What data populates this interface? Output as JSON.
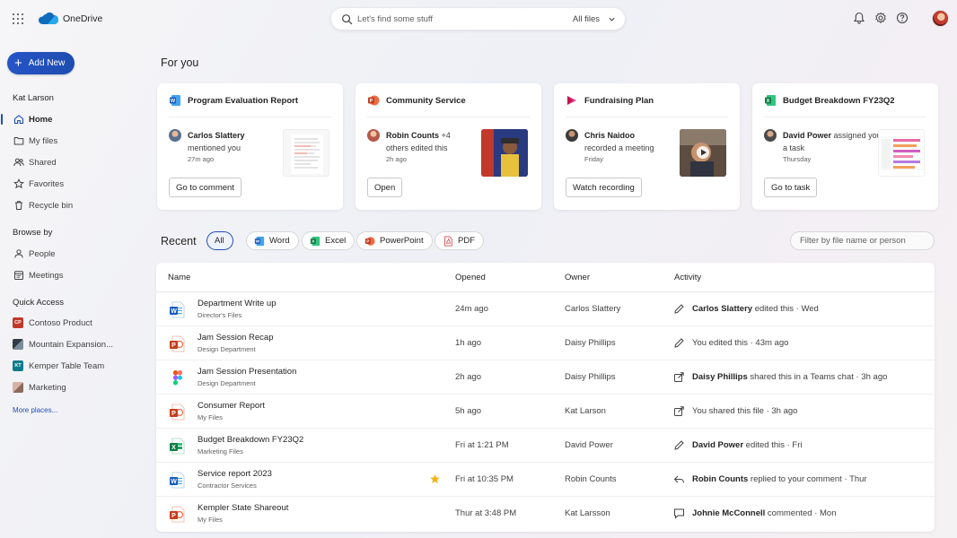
{
  "app": {
    "brand": "OneDrive"
  },
  "search": {
    "placeholder": "Let's find some stuff",
    "scope": "All files"
  },
  "sidebar": {
    "add_new": "Add New",
    "user": "Kat Larson",
    "nav": [
      {
        "label": "Home",
        "icon": "home-icon",
        "active": true
      },
      {
        "label": "My files",
        "icon": "folder-icon"
      },
      {
        "label": "Shared",
        "icon": "people-icon"
      },
      {
        "label": "Favorites",
        "icon": "star-icon"
      },
      {
        "label": "Recycle bin",
        "icon": "trash-icon"
      }
    ],
    "browse_by_title": "Browse by",
    "browse": [
      {
        "label": "People",
        "icon": "person-icon"
      },
      {
        "label": "Meetings",
        "icon": "calendar-icon"
      }
    ],
    "quick_access_title": "Quick Access",
    "quick_access": [
      {
        "label": "Contoso Product",
        "badge": "CP",
        "color": "#c0392b"
      },
      {
        "label": "Mountain Expansion...",
        "badge": "",
        "color": "#2f3b45"
      },
      {
        "label": "Kemper Table Team",
        "badge": "KT",
        "color": "#0f7b8a"
      },
      {
        "label": "Marketing",
        "badge": "",
        "color": "#b98a7a"
      }
    ],
    "more_places": "More places..."
  },
  "for_you": {
    "title": "For you",
    "cards": [
      {
        "app": "word",
        "title": "Program Evaluation Report",
        "person": "Carlos Slattery",
        "action": "mentioned you",
        "time": "27m ago",
        "button": "Go to comment"
      },
      {
        "app": "powerpoint",
        "title": "Community Service",
        "person": "Robin Counts",
        "extra": "+4",
        "action": "others edited this",
        "time": "2h ago",
        "button": "Open"
      },
      {
        "app": "stream",
        "title": "Fundraising Plan",
        "person": "Chris Naidoo",
        "action": "recorded a meeting",
        "time": "Friday",
        "button": "Watch recording"
      },
      {
        "app": "excel",
        "title": "Budget Breakdown FY23Q2",
        "person": "David Power",
        "action": "assigned you a task",
        "time": "Thursday",
        "button": "Go to task"
      }
    ]
  },
  "recent": {
    "title": "Recent",
    "chips": [
      "All",
      "Word",
      "Excel",
      "PowerPoint",
      "PDF"
    ],
    "filter_placeholder": "Filter by file name or person",
    "columns": [
      "Name",
      "Opened",
      "Owner",
      "Activity"
    ],
    "rows": [
      {
        "type": "word",
        "name": "Department Write up",
        "location": "Director's Files",
        "opened": "24m ago",
        "owner": "Carlos Slattery",
        "activity_icon": "pencil-icon",
        "actor": "Carlos Slattery",
        "activity": " edited this · Wed"
      },
      {
        "type": "powerpoint",
        "name": "Jam Session Recap",
        "location": "Design Department",
        "opened": "1h ago",
        "owner": "Daisy Phillips",
        "activity_icon": "pencil-icon",
        "actor": "",
        "activity": "You edited this · 43m ago"
      },
      {
        "type": "figma",
        "name": "Jam Session Presentation",
        "location": "Design Department",
        "opened": "2h ago",
        "owner": "Daisy Phillips",
        "activity_icon": "share-icon",
        "actor": "Daisy Phillips",
        "activity": " shared this in a Teams chat · 3h ago"
      },
      {
        "type": "powerpoint",
        "name": "Consumer Report",
        "location": "My Files",
        "opened": "5h ago",
        "owner": "Kat Larson",
        "activity_icon": "share-icon",
        "actor": "",
        "activity": "You shared this file · 3h ago"
      },
      {
        "type": "excel",
        "name": "Budget Breakdown FY23Q2",
        "location": "Marketing Files",
        "opened": "Fri at 1:21 PM",
        "owner": "David Power",
        "activity_icon": "pencil-icon",
        "actor": "David Power",
        "activity": " edited this · Fri"
      },
      {
        "type": "word",
        "name": "Service report 2023",
        "location": "Contractor Services",
        "opened": "Fri at 10:35 PM",
        "owner": "Robin Counts",
        "activity_icon": "reply-icon",
        "actor": "Robin Counts",
        "activity": " replied to your comment · Thur",
        "starred": true
      },
      {
        "type": "powerpoint",
        "name": "Kempler State Shareout",
        "location": "My Files",
        "opened": "Thur at 3:48 PM",
        "owner": "Kat Larsson",
        "activity_icon": "comment-icon",
        "actor": "Johnie McConnell",
        "activity": " commented · Mon"
      }
    ]
  }
}
